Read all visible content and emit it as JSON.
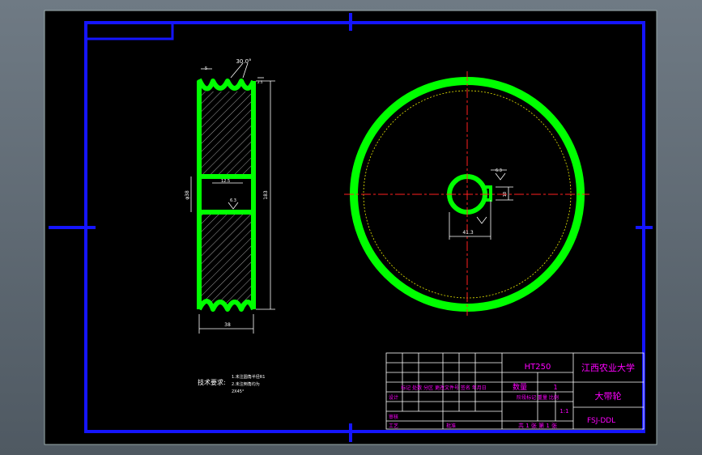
{
  "drawing": {
    "angle_label": "30.0°",
    "width_label": "38",
    "bore_label": "φ38",
    "diameter_label": "183",
    "roughness_1": "6.3",
    "roughness_2": "12.5",
    "keyway_label": "10",
    "keyway_depth": "41.3",
    "side_dim": "2.5",
    "small_label": "5",
    "tech_title": "技术要求:",
    "tech_1": "1.未注圆角半径R1",
    "tech_2": "2.未注倒角均为",
    "tech_3": "2X45°"
  },
  "title_block": {
    "material": "HT250",
    "school": "江西农业大学",
    "part_name": "大带轮",
    "drawing_no": "FSJ-DDL",
    "qty_label": "数量",
    "qty_value": "1",
    "scale_value": "1:1",
    "mark_label": "标记",
    "design_label": "设计",
    "review_label": "审核",
    "craft_label": "工艺",
    "approve_label": "批准",
    "sheets_text": "共 1 张  第 1 张",
    "row_headers": "标记 处数 分区 更改文件号 签名 年月日",
    "stage_labels": "阶段标记  重量  比例"
  },
  "colors": {
    "frame": "#1515ff",
    "pulley": "#00ff00",
    "center": "#ff2020",
    "dim": "#ffffff",
    "tb": "#ff00ff",
    "background": "#000000"
  }
}
